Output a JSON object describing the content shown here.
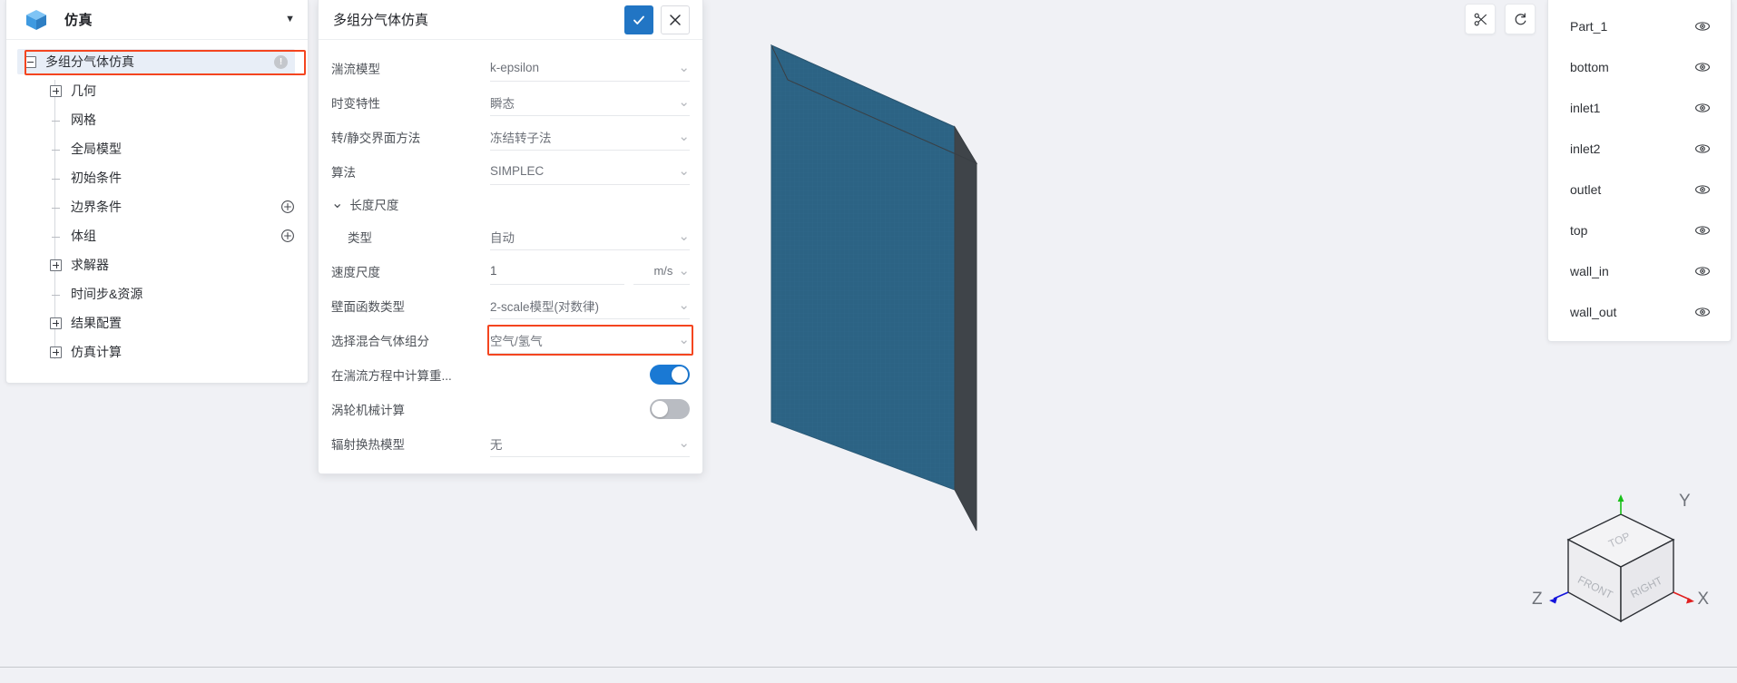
{
  "sidebar": {
    "header_title": "仿真",
    "header_icon": "cube-icon",
    "caret_icon": "chevron-down-icon",
    "tree": [
      {
        "label": "多组分气体仿真",
        "toggle": "minus",
        "depth": 0,
        "selected": true,
        "badge": "info-icon",
        "highlighted": true
      },
      {
        "label": "几何",
        "toggle": "plus",
        "depth": 1
      },
      {
        "label": "网格",
        "toggle": "leaf",
        "depth": 1
      },
      {
        "label": "全局模型",
        "toggle": "leaf",
        "depth": 1
      },
      {
        "label": "初始条件",
        "toggle": "leaf",
        "depth": 1
      },
      {
        "label": "边界条件",
        "toggle": "leaf",
        "depth": 1,
        "action": "add-icon"
      },
      {
        "label": "体组",
        "toggle": "leaf",
        "depth": 1,
        "action": "add-icon"
      },
      {
        "label": "求解器",
        "toggle": "plus",
        "depth": 1
      },
      {
        "label": "时间步&资源",
        "toggle": "leaf",
        "depth": 1
      },
      {
        "label": "结果配置",
        "toggle": "plus",
        "depth": 1
      },
      {
        "label": "仿真计算",
        "toggle": "plus",
        "depth": 1
      }
    ]
  },
  "dialog": {
    "title": "多组分气体仿真",
    "confirm_icon": "check-icon",
    "cancel_icon": "close-icon",
    "rows": [
      {
        "kind": "select",
        "label": "湍流模型",
        "value": "k-epsilon"
      },
      {
        "kind": "select",
        "label": "时变特性",
        "value": "瞬态"
      },
      {
        "kind": "select",
        "label": "转/静交界面方法",
        "value": "冻结转子法"
      },
      {
        "kind": "select",
        "label": "算法",
        "value": "SIMPLEC"
      },
      {
        "kind": "group",
        "label": "长度尺度",
        "caret": "chevron-down-icon"
      },
      {
        "kind": "select",
        "label": "类型",
        "value": "自动",
        "indent": true
      },
      {
        "kind": "number",
        "label": "速度尺度",
        "value": "1",
        "unit": "m/s"
      },
      {
        "kind": "select",
        "label": "壁面函数类型",
        "value": "2-scale模型(对数律)"
      },
      {
        "kind": "select",
        "label": "选择混合气体组分",
        "value": "空气/氢气",
        "highlighted": true
      },
      {
        "kind": "switch",
        "label": "在湍流方程中计算重...",
        "state": "on"
      },
      {
        "kind": "switch",
        "label": "涡轮机械计算",
        "state": "off"
      },
      {
        "kind": "select",
        "label": "辐射换热模型",
        "value": "无"
      }
    ]
  },
  "viewport_toolbar": [
    {
      "name": "scissors-icon",
      "label": "剖切"
    },
    {
      "name": "rotate-icon",
      "label": "旋转"
    }
  ],
  "parts_panel": {
    "items": [
      {
        "label": "Part_1",
        "visibility_icon": "eye-icon"
      },
      {
        "label": "bottom",
        "visibility_icon": "eye-icon"
      },
      {
        "label": "inlet1",
        "visibility_icon": "eye-icon"
      },
      {
        "label": "inlet2",
        "visibility_icon": "eye-icon"
      },
      {
        "label": "outlet",
        "visibility_icon": "eye-icon"
      },
      {
        "label": "top",
        "visibility_icon": "eye-icon"
      },
      {
        "label": "wall_in",
        "visibility_icon": "eye-icon"
      },
      {
        "label": "wall_out",
        "visibility_icon": "eye-icon"
      }
    ]
  },
  "view_cube": {
    "faces": {
      "top": "TOP",
      "front": "FRONT",
      "right": "RIGHT"
    },
    "axes": {
      "x": "X",
      "y": "Y",
      "z": "Z"
    },
    "axis_colors": {
      "x": "#e02020",
      "y": "#18c018",
      "z": "#1414dc"
    }
  },
  "colors": {
    "accent": "#2175c4",
    "highlight": "#f4451f",
    "toggle_on": "#1a79d4",
    "canvas_bg": "#f0f1f5",
    "solid_face": "#2c6384",
    "solid_side": "#4a4f54"
  }
}
